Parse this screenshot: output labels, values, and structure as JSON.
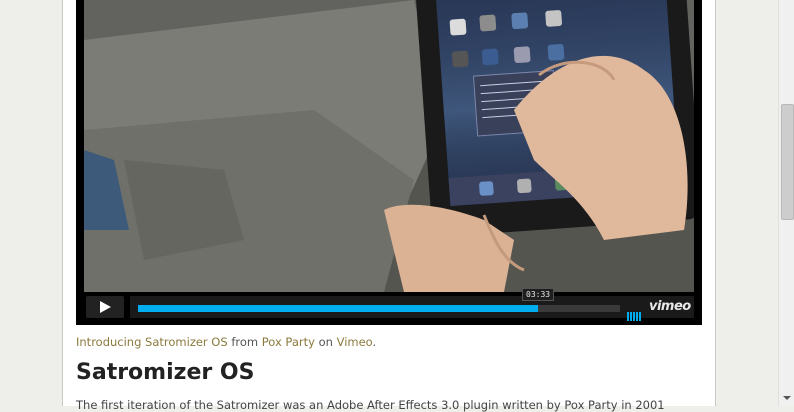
{
  "player": {
    "timestamp": "03:33",
    "progress": 0.83,
    "brand": "vimeo",
    "accent_color": "#00adef"
  },
  "caption": {
    "video_title": "Introducing Satromizer OS",
    "from_word": "from",
    "author": "Pox Party",
    "on_word": "on",
    "site": "Vimeo",
    "end": "."
  },
  "article": {
    "title": "Satromizer OS",
    "intro_visible": "The first iteration of the Satromizer was an Adobe After Effects 3.0 plugin written by Pox Party in 2001"
  },
  "icons": {
    "play": "play-icon",
    "volume": "volume-icon",
    "scroll_down": "chevron-down-icon"
  }
}
